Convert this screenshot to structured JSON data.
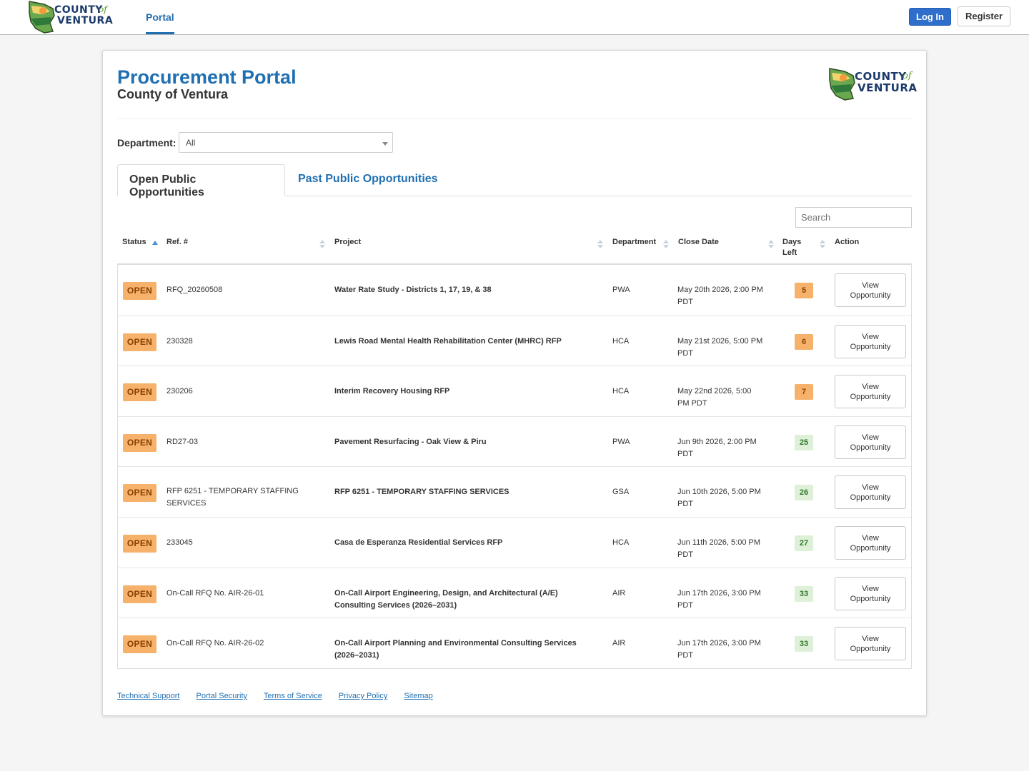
{
  "nav": {
    "logo_county": "COUNTY",
    "logo_of": "of",
    "logo_ventura": "VENTURA",
    "portal_tab": "Portal",
    "login": "Log In",
    "register": "Register"
  },
  "header": {
    "title": "Procurement Portal",
    "subtitle": "County of Ventura"
  },
  "filter": {
    "label": "Department:",
    "value": "All"
  },
  "tabs": {
    "open": "Open Public Opportunities",
    "past": "Past Public Opportunities"
  },
  "search": {
    "placeholder": "Search"
  },
  "columns": {
    "status": "Status",
    "ref": "Ref. #",
    "project": "Project",
    "department": "Department",
    "close_date": "Close Date",
    "days_left_1": "Days",
    "days_left_2": "Left",
    "action": "Action"
  },
  "rows": [
    {
      "status": "OPEN",
      "ref1": "RFQ_20260508",
      "ref2": "",
      "proj1": "Water Rate Study - Districts 1, 17, 19, & 38",
      "proj2": "",
      "dept": "PWA",
      "date1": "May 20th 2026, 2:00 PM",
      "date2": "PDT",
      "days": "5",
      "btn1": "View",
      "btn2": "Opportunity"
    },
    {
      "status": "OPEN",
      "ref1": "230328",
      "ref2": "",
      "proj1": "Lewis Road Mental Health Rehabilitation Center (MHRC) RFP",
      "proj2": "",
      "dept": "HCA",
      "date1": "May 21st 2026, 5:00 PM",
      "date2": "PDT",
      "days": "6",
      "btn1": "View",
      "btn2": "Opportunity"
    },
    {
      "status": "OPEN",
      "ref1": "230206",
      "ref2": "",
      "proj1": "Interim Recovery Housing RFP",
      "proj2": "",
      "dept": "HCA",
      "date1": "May 22nd 2026, 5:00",
      "date2": "PM PDT",
      "days": "7",
      "btn1": "View",
      "btn2": "Opportunity"
    },
    {
      "status": "OPEN",
      "ref1": "RD27-03",
      "ref2": "",
      "proj1": "Pavement Resurfacing - Oak View & Piru",
      "proj2": "",
      "dept": "PWA",
      "date1": "Jun 9th 2026, 2:00 PM",
      "date2": "PDT",
      "days": "25",
      "btn1": "View",
      "btn2": "Opportunity"
    },
    {
      "status": "OPEN",
      "ref1": "RFP 6251 - TEMPORARY STAFFING",
      "ref2": "SERVICES",
      "proj1": "RFP 6251 - TEMPORARY STAFFING SERVICES",
      "proj2": "",
      "dept": "GSA",
      "date1": "Jun 10th 2026, 5:00 PM",
      "date2": "PDT",
      "days": "26",
      "btn1": "View",
      "btn2": "Opportunity"
    },
    {
      "status": "OPEN",
      "ref1": "233045",
      "ref2": "",
      "proj1": "Casa de Esperanza Residential Services RFP",
      "proj2": "",
      "dept": "HCA",
      "date1": "Jun 11th 2026, 5:00 PM",
      "date2": "PDT",
      "days": "27",
      "btn1": "View",
      "btn2": "Opportunity"
    },
    {
      "status": "OPEN",
      "ref1": "On-Call RFQ No. AIR-26-01",
      "ref2": "",
      "proj1": "On-Call Airport Engineering, Design, and Architectural (A/E)",
      "proj2": "Consulting Services (2026–2031)",
      "dept": "AIR",
      "date1": "Jun 17th 2026, 3:00 PM",
      "date2": "PDT",
      "days": "33",
      "btn1": "View",
      "btn2": "Opportunity"
    },
    {
      "status": "OPEN",
      "ref1": "On-Call RFQ No. AIR-26-02",
      "ref2": "",
      "proj1": "On-Call Airport Planning and Environmental Consulting Services",
      "proj2": "(2026–2031)",
      "dept": "AIR",
      "date1": "Jun 17th 2026, 3:00 PM",
      "date2": "PDT",
      "days": "33",
      "btn1": "View",
      "btn2": "Opportunity"
    }
  ],
  "days_urgency": [
    "warn",
    "warn",
    "warn",
    "ok",
    "ok",
    "ok",
    "ok",
    "ok"
  ],
  "footer": {
    "technical_support": "Technical Support",
    "portal_security": "Portal Security",
    "terms": "Terms of Service",
    "privacy": "Privacy Policy",
    "sitemap": "Sitemap"
  },
  "colors": {
    "brand_blue": "#1f6fb2",
    "open_badge": "#f6b16b",
    "days_warn": "#f6b16b",
    "days_ok": "#dff0d8"
  }
}
